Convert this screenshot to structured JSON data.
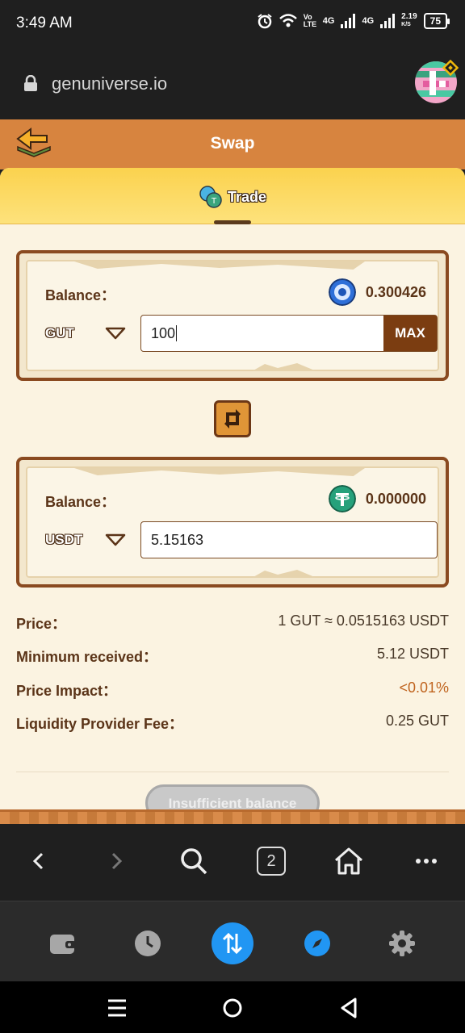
{
  "status": {
    "time": "3:49 AM",
    "volte": "Vo LTE",
    "net1": "4G",
    "net2": "4G",
    "speed": "2.19",
    "speed_unit": "K/S",
    "battery": "75"
  },
  "browser": {
    "url": "genuniverse.io",
    "tabs_count": "2"
  },
  "header": {
    "title": "Swap"
  },
  "tabs": {
    "active": "Trade"
  },
  "from": {
    "balance_label": "Balance：",
    "balance_value": "0.300426",
    "token": "GUT",
    "amount": "100",
    "max_label": "MAX"
  },
  "to": {
    "balance_label": "Balance：",
    "balance_value": "0.000000",
    "token": "USDT",
    "amount": "5.15163"
  },
  "details": {
    "price_label": "Price：",
    "price_value": "1 GUT ≈ 0.0515163 USDT",
    "min_label": "Minimum received：",
    "min_value": "5.12 USDT",
    "impact_label": "Price Impact：",
    "impact_value": "<0.01%",
    "fee_label": "Liquidity Provider Fee：",
    "fee_value": "0.25 GUT"
  },
  "action": {
    "label": "Insufficient balance"
  },
  "colors": {
    "header": "#d7843f",
    "accent_brown": "#5b3418",
    "impact": "#c0641f",
    "active_nav": "#2196f3"
  },
  "icons": {
    "back": "back-arrow-icon",
    "swap": "swap-arrows-icon",
    "gut_coin": "gut-coin-icon",
    "usdt_coin": "tether-coin-icon"
  }
}
